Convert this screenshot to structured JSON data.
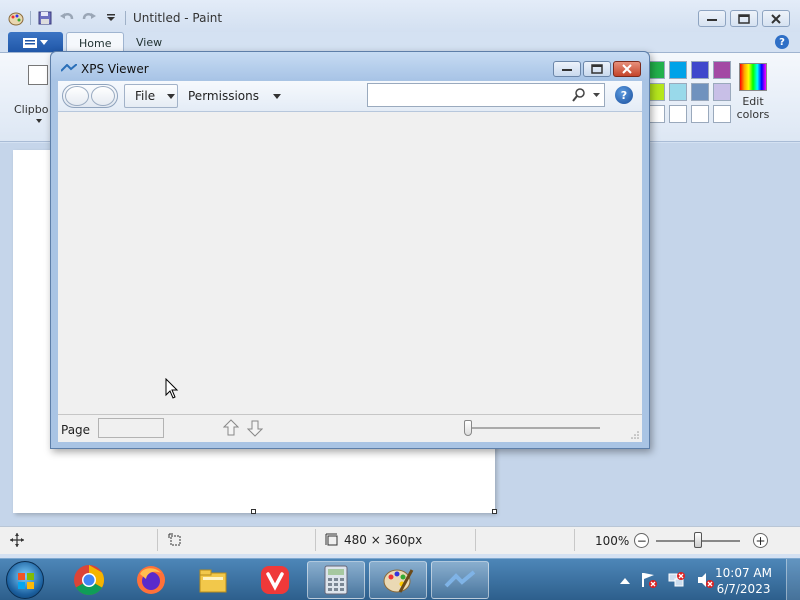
{
  "paint": {
    "title": "Untitled - Paint",
    "tabs": [
      {
        "label": "Home"
      },
      {
        "label": "View"
      }
    ],
    "clipboard_label": "Clipbo",
    "edit_colors_line1": "Edit",
    "edit_colors_line2": "colors",
    "help_glyph": "?",
    "swatches": [
      "#22b14c",
      "#00a2e8",
      "#3f48cc",
      "#a349a4",
      "#b5e61d",
      "#99d9ea",
      "#7092be",
      "#c8bfe7",
      "#ffffff",
      "#ffffff",
      "#ffffff",
      "#ffffff"
    ],
    "status": {
      "dimensions": "480 × 360px",
      "zoom": "100%",
      "zoom_out_glyph": "−",
      "zoom_in_glyph": "+",
      "zoom_level": 0.5
    }
  },
  "xps": {
    "title": "XPS Viewer",
    "file_label": "File",
    "permissions_label": "Permissions",
    "search_value": "",
    "help_glyph": "?",
    "page_label": "Page",
    "page_value": ""
  },
  "taskbar": {
    "apps": [
      "chrome-icon",
      "firefox-icon",
      "file-explorer-icon",
      "vivaldi-icon",
      "calculator-icon",
      "paint-icon",
      "xps-viewer-icon"
    ],
    "time": "10:07 AM",
    "date": "6/7/2023"
  },
  "colors": {
    "accent": "#2f6fc6",
    "taskbar": "#3a6f9e",
    "close_red": "#c4442a"
  }
}
